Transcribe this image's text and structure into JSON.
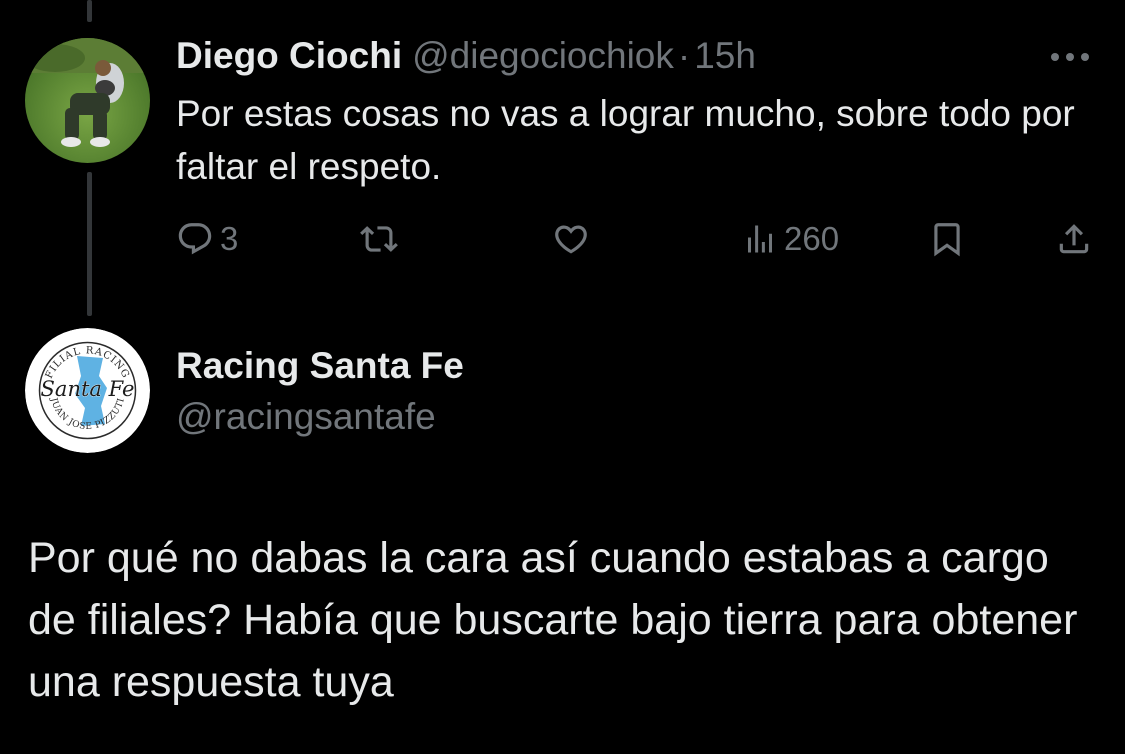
{
  "thread": {
    "reply": {
      "author_name": "Diego Ciochi",
      "handle": "@diegociochiok",
      "separator": "·",
      "time": "15h",
      "text": "Por estas cosas no vas a lograr mucho, sobre todo por faltar el respeto.",
      "actions": {
        "replies_count": "3",
        "views_count": "260"
      },
      "icons": [
        "more-icon",
        "reply-icon",
        "retweet-icon",
        "like-icon",
        "views-icon",
        "bookmark-icon",
        "share-icon"
      ]
    },
    "main_tweet": {
      "author_name": "Racing Santa Fe",
      "handle": "@racingsantafe",
      "text": "Por qué no dabas la cara así cuando estabas a cargo de filiales? Había que buscarte bajo tierra para obtener una respuesta tuya",
      "avatar_logo": {
        "top_text": "FILIAL RACING",
        "center_text": "Santa Fe",
        "bottom_text": "JUAN JOSE PIZZUTI"
      }
    }
  },
  "colors": {
    "background": "#000000",
    "text_primary": "#e7e9ea",
    "text_secondary": "#71767b",
    "thread_line": "#333639",
    "logo_blue": "#5fb2e3"
  }
}
